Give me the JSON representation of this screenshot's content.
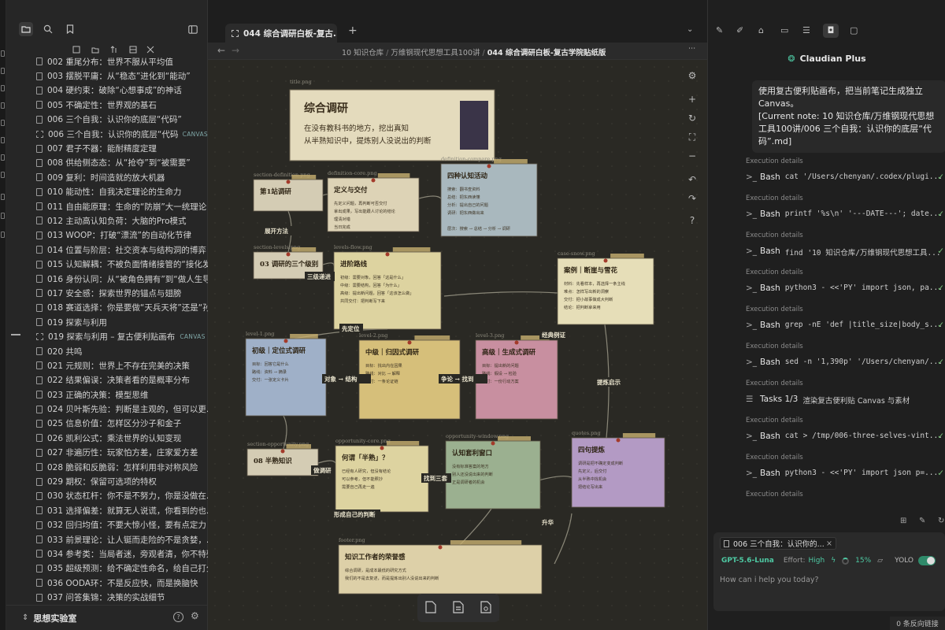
{
  "sidebar": {
    "files": [
      {
        "name": "002 重尾分布：世界不服从平均值",
        "type": "note"
      },
      {
        "name": "003 摆脱平庸：从“稳态”进化到“能动”",
        "type": "note"
      },
      {
        "name": "004 硬约束：破除“心想事成”的神话",
        "type": "note"
      },
      {
        "name": "005 不确定性：世界观的基石",
        "type": "note"
      },
      {
        "name": "006 三个自我：认识你的底层“代码”",
        "type": "note"
      },
      {
        "name": "006 三个自我：认识你的底层“代码...",
        "type": "canvas",
        "badge": "CANVAS"
      },
      {
        "name": "007 君子不器：能耐精度定理",
        "type": "note"
      },
      {
        "name": "008 供给侧态态：从“抢夺”到“被需要”",
        "type": "note"
      },
      {
        "name": "009 复利：时间造就的放大机器",
        "type": "note"
      },
      {
        "name": "010 能动性：自我决定理论的生命力",
        "type": "note"
      },
      {
        "name": "011 自由能原理：生命的“防崩”大一统理论",
        "type": "note"
      },
      {
        "name": "012 主动高认知负荷：大脑的Pro模式",
        "type": "note"
      },
      {
        "name": "013 WOOP：打破“漂流”的自动化节律",
        "type": "note"
      },
      {
        "name": "014 位置与阶层：社交资本与结构洞的博弈",
        "type": "note"
      },
      {
        "name": "015 认知解耦：不被负面情绪接管的“接化发”",
        "type": "note"
      },
      {
        "name": "016 身份认同：从“被角色拥有”到“做人生导...",
        "type": "note"
      },
      {
        "name": "017 安全感：探索世界的锚点与翅膀",
        "type": "note"
      },
      {
        "name": "018 赛道选择：你是要做“天兵天将”还是“孙...",
        "type": "note"
      },
      {
        "name": "019 探索与利用",
        "type": "note"
      },
      {
        "name": "019 探索与利用 – 复古便利贴画布",
        "type": "canvas",
        "badge": "CANVAS"
      },
      {
        "name": "020 共鸣",
        "type": "note"
      },
      {
        "name": "021 元规则：世界上不存在完美的决策",
        "type": "note"
      },
      {
        "name": "022 结果偏误：决策者看的是概率分布",
        "type": "note"
      },
      {
        "name": "023 正确的决策：模型思维",
        "type": "note"
      },
      {
        "name": "024 贝叶斯先验：判断是主观的，但可以更...",
        "type": "note"
      },
      {
        "name": "025 信息价值：怎样区分沙子和金子",
        "type": "note"
      },
      {
        "name": "026 凯利公式：乘法世界的认知变现",
        "type": "note"
      },
      {
        "name": "027 非遍历性：玩家怕方差，庄家爱方差",
        "type": "note"
      },
      {
        "name": "028 脆弱和反脆弱：怎样利用非对称风险",
        "type": "note"
      },
      {
        "name": "029 期权：保留可选项的特权",
        "type": "note"
      },
      {
        "name": "030 状态杠杆：你不是不努力，你是没做在...",
        "type": "note"
      },
      {
        "name": "031 选择偏差：就算无人说谎，你看到的也...",
        "type": "note"
      },
      {
        "name": "032 回归均值：不要大惊小怪，要有点定力",
        "type": "note"
      },
      {
        "name": "033 前景理论：让人铤而走险的不是贪婪，...",
        "type": "note"
      },
      {
        "name": "034 参考类：当局者迷，旁观者清，你不特殊",
        "type": "note"
      },
      {
        "name": "035 超级预测：给不确定性命名，给自己打分",
        "type": "note"
      },
      {
        "name": "036 OODA环：不是反应快，而是换脑快",
        "type": "note"
      },
      {
        "name": "037 问答集锦：决策的实战细节",
        "type": "note"
      }
    ],
    "vault_name": "思想实验室",
    "icons": [
      "folder-icon",
      "search-icon",
      "bookmark-icon",
      "sidebar-toggle-icon"
    ]
  },
  "center": {
    "tab_title": "044 综合调研白板-复古...",
    "crumbs": [
      "10 知识仓库",
      "万维钢现代思想工具100讲",
      "044 综合调研白板-复古学院贴纸版"
    ],
    "canvas": {
      "title_card": {
        "label": "title.png",
        "heading": "综合调研",
        "line1": "在没有教科书的地方，挖出真知",
        "line2": "从半熟知识中，提炼别人没说出的判断"
      },
      "cards": [
        {
          "label": "section-definition.png",
          "title": "第1站调研",
          "color": "#d4ccb4"
        },
        {
          "label": "definition-core.png",
          "title": "定义与交付",
          "color": "#ddd3b6",
          "lines": [
            "先定义问题，再判断可否交付",
            "拿出成果，写出能跟人讨论的结论",
            "理清对错",
            "当日完成"
          ]
        },
        {
          "label": "definition-compare.png",
          "title": "四种认知活动",
          "color": "#a9b8be",
          "lines": [
            "搜索：翻书查资料",
            "总结：把东西读懂",
            "分析：提出自己的问题",
            "调研：把东西做出来"
          ],
          "note": "层次：搜索 → 总结 → 分析 → 调研"
        },
        {
          "label": "section-levels.png",
          "title": "03 调研的三个级别",
          "color": "#d4ccb4"
        },
        {
          "label": "levels-flow.png",
          "title": "进阶路线",
          "color": "#ddd3a0",
          "lines": [
            "初级：需要对象，回答「这是什么」",
            "中级：需要结构，回答「为什么」",
            "高级：提出新问题，回答「这该怎么做」",
            "共同交付：把判断写下来"
          ]
        },
        {
          "label": "case-snow.png",
          "title": "案例｜断崖与雪花",
          "color": "#e6deb8",
          "lines": [
            "材料：先看样本，再选择一条主线",
            "难点：怎样写出新的洞察",
            "交付：把小故事做成大判断",
            "结论：把判断拿来用"
          ]
        },
        {
          "label": "level-1.png",
          "title": "初级｜定位式调研",
          "color": "#9fb0c8",
          "lines": [
            "目标：回答它是什么",
            "路线：资料 → 摘录",
            "交付：一张定义卡片"
          ]
        },
        {
          "label": "level-2.png",
          "title": "中级｜归因式调研",
          "color": "#d6bf7a",
          "lines": [
            "目标：找出内在因果",
            "路线：对比 → 解释",
            "交付：一条论证链"
          ]
        },
        {
          "label": "level-3.png",
          "title": "高级｜生成式调研",
          "color": "#c88fa0",
          "lines": [
            "目标：提出新的问题",
            "路线：假设 → 检验",
            "交付：一份行动方案"
          ]
        },
        {
          "label": "section-opportunity.png",
          "title": "08 半熟知识",
          "color": "#d4ccb4"
        },
        {
          "label": "opportunity-core.png",
          "title": "何谓「半熟」？",
          "color": "#ddd3a0",
          "lines": [
            "已经有人研究，但没有结论",
            "可以参考，但不能照抄",
            "需要自己再走一遍"
          ]
        },
        {
          "label": "opportunity-window.png",
          "title": "认知套利窗口",
          "color": "#9bb090",
          "lines": [
            "没有标准答案的地方",
            "别人还没说出来的判断",
            "正是调研者的机会"
          ]
        },
        {
          "label": "quotes.png",
          "title": "四句提炼",
          "color": "#b39ac4",
          "lines": [
            "调研是把不确定变成判断",
            "先定义，后交付",
            "从半熟中找机会",
            "把结论写出来"
          ]
        },
        {
          "label": "footer.png",
          "title": "知识工作者的荣誉感",
          "color": "#ddd0a8",
          "lines": [
            "综合调研，是成本最低的研究方式",
            "我们的不是去复述，而是提炼出别人没说出来的判断"
          ]
        }
      ],
      "flow_labels": [
        "展开方法",
        "三级递进",
        "先定位",
        "经典例证",
        "提炼启示",
        "对象 → 结构",
        "争论 → 找到",
        "做调研",
        "找到三套",
        "形成自己的判断",
        "升华"
      ]
    }
  },
  "right": {
    "plugin_title": "Claudian Plus",
    "user_message": [
      "使用复古便利贴画布，把当前笔记生成独立Canvas。",
      "[Current note: 10 知识仓库/万维钢现代思想工具100讲/006 三个自我：认识你的底层“代码”.md]"
    ],
    "exec_label": "Execution details",
    "steps": [
      {
        "tool": "Bash",
        "cmd": "cat '/Users/chenyan/.codex/plugi..."
      },
      {
        "tool": "Bash",
        "cmd": "printf '%s\\n' '---DATE---'; date..."
      },
      {
        "tool": "Bash",
        "cmd": "find '10 知识仓库/万维钢现代思想工具..."
      },
      {
        "tool": "Bash",
        "cmd": "python3 - <<'PY' import json, pa..."
      },
      {
        "tool": "Bash",
        "cmd": "grep -nE 'def |title_size|body_s..."
      },
      {
        "tool": "Bash",
        "cmd": "sed -n '1,390p' '/Users/chenyan/..."
      },
      {
        "tool": "Tasks 1/3",
        "cmd": "渲染复古便利贴 Canvas 与素材",
        "task": true
      },
      {
        "tool": "Bash",
        "cmd": "cat > /tmp/006-three-selves-vint..."
      },
      {
        "tool": "Bash",
        "cmd": "python3 - <<'PY' import json p=..."
      }
    ],
    "context_chip": "006 三个自我：认识你的...",
    "model": "GPT-5.6-Luna",
    "effort_label": "Effort:",
    "effort_value": "High",
    "context_pct": "15%",
    "yolo": "YOLO",
    "input_placeholder": "How can i help you today?"
  },
  "status_bar": "0 条反向链接",
  "colors": {
    "accent": "#4ec9a3",
    "board": "#2a2924",
    "check": "#7ac27a"
  }
}
